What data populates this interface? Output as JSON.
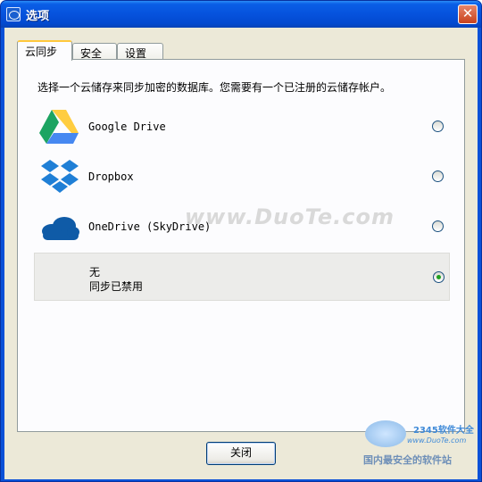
{
  "window": {
    "title": "选项",
    "close_glyph": "✕"
  },
  "tabs": [
    {
      "label": "云同步",
      "active": true
    },
    {
      "label": "安全",
      "active": false
    },
    {
      "label": "设置",
      "active": false
    }
  ],
  "sync": {
    "description": "选择一个云储存来同步加密的数据库。您需要有一个已注册的云储存帐户。",
    "providers": [
      {
        "name": "Google Drive",
        "icon": "google-drive-icon",
        "selected": false
      },
      {
        "name": "Dropbox",
        "icon": "dropbox-icon",
        "selected": false
      },
      {
        "name": "OneDrive (SkyDrive)",
        "icon": "onedrive-icon",
        "selected": false
      },
      {
        "name": "无",
        "subtitle": "同步已禁用",
        "icon": "",
        "selected": true
      }
    ]
  },
  "footer": {
    "close_label": "关闭"
  },
  "overlay": {
    "watermark": "www.DuoTe.com",
    "brand_top": "2345软件大全",
    "brand_url": "www.DuoTe.com",
    "brand_slogan": "国内最安全的软件站"
  },
  "colors": {
    "titlebar": "#0652dd",
    "google_green": "#1da462",
    "google_yellow": "#ffcd40",
    "google_blue": "#4688f1",
    "dropbox_blue": "#1f7fd6",
    "onedrive_blue": "#0f5ba7",
    "radio_checked": "#21a121"
  }
}
